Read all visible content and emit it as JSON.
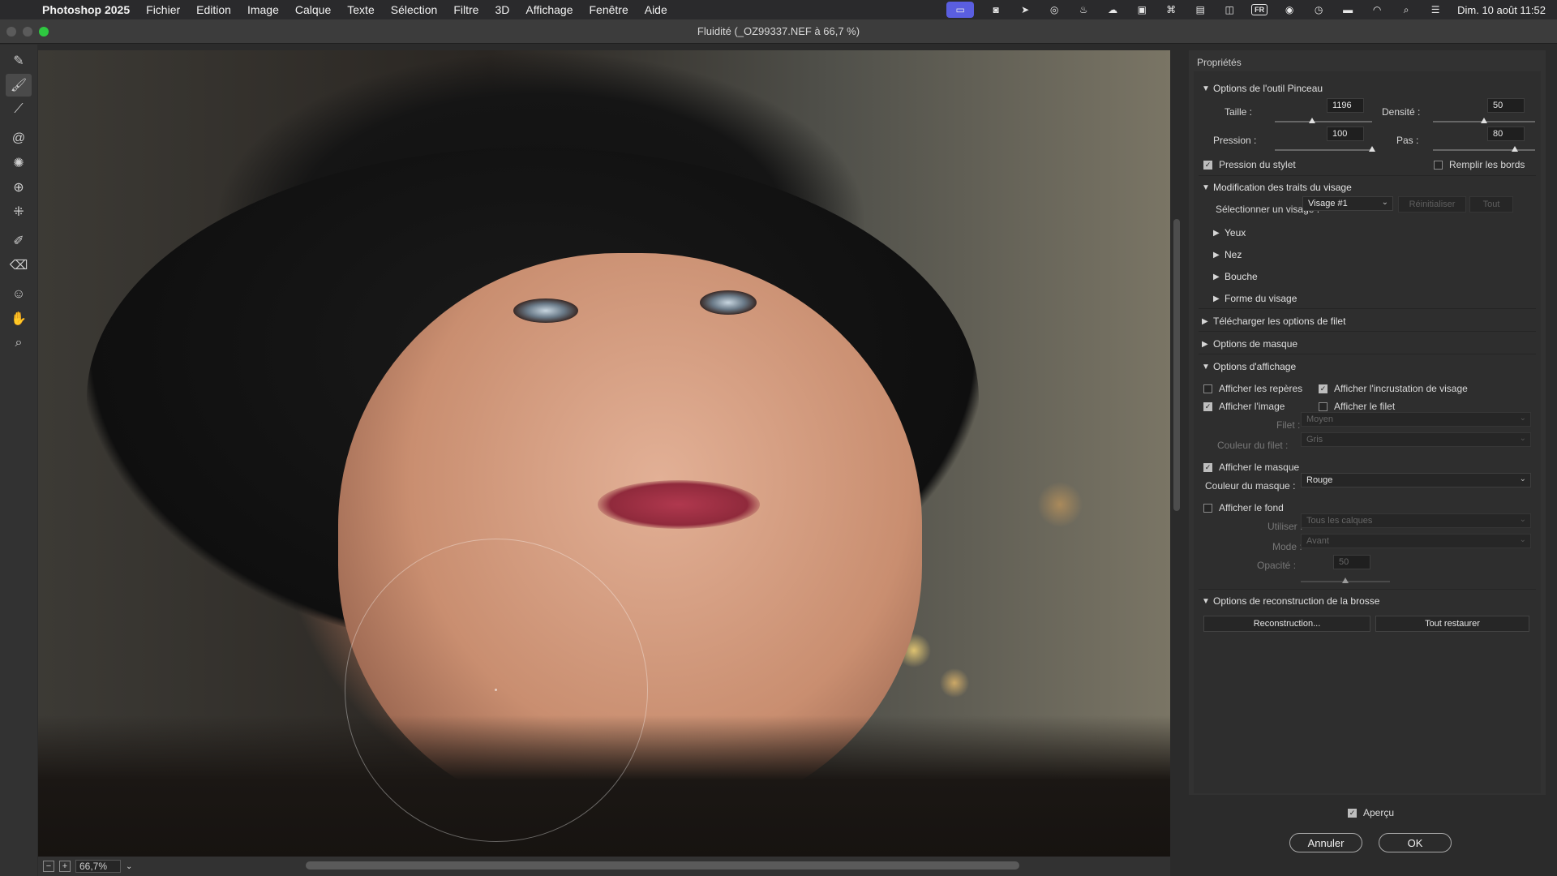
{
  "menubar": {
    "app": "Photoshop 2025",
    "items": [
      "Fichier",
      "Edition",
      "Image",
      "Calque",
      "Texte",
      "Sélection",
      "Filtre",
      "3D",
      "Affichage",
      "Fenêtre",
      "Aide"
    ],
    "input_badge": "FR",
    "clock": "Dim. 10 août  11:52"
  },
  "window": {
    "title": "Fluidité (_OZ99337.NEF à 66,7 %)"
  },
  "status": {
    "zoom": "66,7%"
  },
  "panel": {
    "title": "Propriétés",
    "brush": {
      "section": "Options de l'outil Pinceau",
      "size_label": "Taille :",
      "size_value": "1196",
      "size_pos": 0.38,
      "density_label": "Densité :",
      "density_value": "50",
      "density_pos": 0.5,
      "pressure_label": "Pression :",
      "pressure_value": "100",
      "pressure_pos": 1.0,
      "rate_label": "Pas :",
      "rate_value": "80",
      "rate_pos": 0.8,
      "stylus_label": "Pression du stylet",
      "stylus_checked": true,
      "pin_edges_label": "Remplir les bords",
      "pin_edges_checked": false
    },
    "face": {
      "section": "Modification des traits du visage",
      "select_label": "Sélectionner un visage :",
      "select_value": "Visage #1",
      "reset_label": "Réinitialiser",
      "all_label": "Tout",
      "sub": [
        "Yeux",
        "Nez",
        "Bouche",
        "Forme du visage"
      ]
    },
    "mesh_section": "Télécharger les options de filet",
    "mask_section": "Options de masque",
    "view": {
      "section": "Options d'affichage",
      "guides_label": "Afficher les repères",
      "guides_checked": false,
      "overlay_label": "Afficher l'incrustation de visage",
      "overlay_checked": true,
      "image_label": "Afficher l'image",
      "image_checked": true,
      "mesh_label": "Afficher le filet",
      "mesh_checked": false,
      "mesh_size_label": "Filet :",
      "mesh_size_value": "Moyen",
      "mesh_color_label": "Couleur du filet :",
      "mesh_color_value": "Gris",
      "show_mask_label": "Afficher le masque",
      "show_mask_checked": true,
      "mask_color_label": "Couleur du masque :",
      "mask_color_value": "Rouge",
      "backdrop_label": "Afficher le fond",
      "backdrop_checked": false,
      "use_label": "Utiliser :",
      "use_value": "Tous les calques",
      "mode_label": "Mode :",
      "mode_value": "Avant",
      "opacity_label": "Opacité :",
      "opacity_value": "50",
      "opacity_pos": 0.5
    },
    "reconstruct": {
      "section": "Options de reconstruction de la brosse",
      "reconstruct_label": "Reconstruction...",
      "restore_label": "Tout restaurer"
    }
  },
  "footer": {
    "preview_label": "Aperçu",
    "preview_checked": true,
    "cancel_label": "Annuler",
    "ok_label": "OK"
  }
}
